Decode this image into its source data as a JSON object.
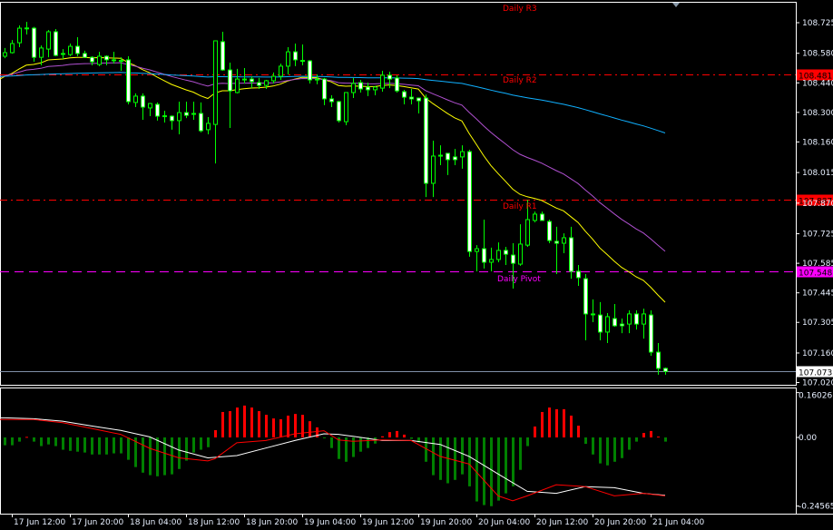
{
  "chart_data": {
    "type": "candlestick",
    "timeframe_step_hours": 1,
    "candles_ohlc": [
      [
        108.566,
        108.605,
        108.557,
        108.583
      ],
      [
        108.583,
        108.643,
        108.579,
        108.626
      ],
      [
        108.63,
        108.712,
        108.609,
        108.699
      ],
      [
        108.699,
        108.729,
        108.669,
        108.7
      ],
      [
        108.699,
        108.705,
        108.54,
        108.561
      ],
      [
        108.561,
        108.617,
        108.523,
        108.605
      ],
      [
        108.6,
        108.69,
        108.561,
        108.682
      ],
      [
        108.682,
        108.695,
        108.566,
        108.57
      ],
      [
        108.579,
        108.6,
        108.553,
        108.575
      ],
      [
        108.574,
        108.626,
        108.566,
        108.613
      ],
      [
        108.613,
        108.656,
        108.566,
        108.579
      ],
      [
        108.579,
        108.592,
        108.561,
        108.561
      ],
      [
        108.561,
        108.566,
        108.523,
        108.54
      ],
      [
        108.527,
        108.587,
        108.519,
        108.566
      ],
      [
        108.566,
        108.57,
        108.523,
        108.549
      ],
      [
        108.549,
        108.587,
        108.531,
        108.548
      ],
      [
        108.544,
        108.561,
        108.497,
        108.546
      ],
      [
        108.549,
        108.566,
        108.338,
        108.351
      ],
      [
        108.347,
        108.39,
        108.325,
        108.377
      ],
      [
        108.377,
        108.39,
        108.265,
        108.325
      ],
      [
        108.321,
        108.345,
        108.282,
        108.342
      ],
      [
        108.338,
        108.347,
        108.261,
        108.282
      ],
      [
        108.282,
        108.308,
        108.252,
        108.284
      ],
      [
        108.282,
        108.286,
        108.218,
        108.261
      ],
      [
        108.261,
        108.351,
        108.196,
        108.299
      ],
      [
        108.299,
        108.351,
        108.273,
        108.286
      ],
      [
        108.295,
        108.351,
        108.265,
        108.292
      ],
      [
        108.295,
        108.347,
        108.205,
        108.213
      ],
      [
        108.218,
        108.278,
        108.196,
        108.248
      ],
      [
        108.243,
        108.639,
        108.058,
        108.639
      ],
      [
        108.635,
        108.682,
        108.497,
        108.501
      ],
      [
        108.501,
        108.536,
        108.226,
        108.402
      ],
      [
        108.394,
        108.506,
        108.39,
        108.458
      ],
      [
        108.458,
        108.51,
        108.437,
        108.456
      ],
      [
        108.458,
        108.471,
        108.415,
        108.446
      ],
      [
        108.441,
        108.463,
        108.411,
        108.428
      ],
      [
        108.428,
        108.454,
        108.411,
        108.45
      ],
      [
        108.45,
        108.489,
        108.437,
        108.471
      ],
      [
        108.471,
        108.531,
        108.454,
        108.519
      ],
      [
        108.519,
        108.609,
        108.48,
        108.587
      ],
      [
        108.587,
        108.626,
        108.519,
        108.549
      ],
      [
        108.544,
        108.622,
        108.523,
        108.546
      ],
      [
        108.544,
        108.548,
        108.437,
        108.454
      ],
      [
        108.458,
        108.48,
        108.433,
        108.456
      ],
      [
        108.458,
        108.463,
        108.334,
        108.364
      ],
      [
        108.364,
        108.381,
        108.325,
        108.351
      ],
      [
        108.351,
        108.355,
        108.252,
        108.261
      ],
      [
        108.256,
        108.394,
        108.239,
        108.394
      ],
      [
        108.394,
        108.463,
        108.368,
        108.437
      ],
      [
        108.441,
        108.454,
        108.394,
        108.411
      ],
      [
        108.42,
        108.441,
        108.377,
        108.407
      ],
      [
        108.407,
        108.424,
        108.381,
        108.42
      ],
      [
        108.415,
        108.497,
        108.398,
        108.476
      ],
      [
        108.476,
        108.493,
        108.415,
        108.458
      ],
      [
        108.463,
        108.476,
        108.394,
        108.402
      ],
      [
        108.398,
        108.407,
        108.338,
        108.372
      ],
      [
        108.372,
        108.411,
        108.338,
        108.364
      ],
      [
        108.368,
        108.371,
        108.295,
        108.355
      ],
      [
        108.368,
        108.385,
        107.899,
        107.964
      ],
      [
        107.964,
        108.166,
        107.899,
        108.093
      ],
      [
        108.097,
        108.144,
        108.05,
        108.095
      ],
      [
        108.106,
        108.106,
        108.003,
        108.076
      ],
      [
        108.089,
        108.127,
        108.05,
        108.076
      ],
      [
        108.089,
        108.144,
        108.033,
        108.114
      ],
      [
        108.114,
        108.123,
        107.616,
        107.641
      ],
      [
        107.641,
        107.671,
        107.547,
        107.654
      ],
      [
        107.654,
        107.792,
        107.56,
        107.59
      ],
      [
        107.59,
        107.659,
        107.547,
        107.603
      ],
      [
        107.603,
        107.684,
        107.59,
        107.646
      ],
      [
        107.646,
        107.663,
        107.577,
        107.628
      ],
      [
        107.624,
        107.68,
        107.465,
        107.585
      ],
      [
        107.581,
        107.77,
        107.573,
        107.676
      ],
      [
        107.671,
        107.886,
        107.663,
        107.792
      ],
      [
        107.788,
        107.83,
        107.779,
        107.818
      ],
      [
        107.818,
        107.83,
        107.788,
        107.788
      ],
      [
        107.783,
        107.792,
        107.68,
        107.693
      ],
      [
        107.689,
        107.758,
        107.534,
        107.68
      ],
      [
        107.68,
        107.727,
        107.633,
        107.706
      ],
      [
        107.706,
        107.758,
        107.512,
        107.547
      ],
      [
        107.547,
        107.577,
        107.478,
        107.517
      ],
      [
        107.512,
        107.534,
        107.22,
        107.345
      ],
      [
        107.345,
        107.414,
        107.306,
        107.343
      ],
      [
        107.34,
        107.401,
        107.22,
        107.259
      ],
      [
        107.259,
        107.349,
        107.207,
        107.332
      ],
      [
        107.323,
        107.392,
        107.284,
        107.289
      ],
      [
        107.297,
        107.323,
        107.254,
        107.289
      ],
      [
        107.297,
        107.362,
        107.254,
        107.345
      ],
      [
        107.345,
        107.362,
        107.271,
        107.297
      ],
      [
        107.297,
        107.37,
        107.228,
        107.345
      ],
      [
        107.34,
        107.362,
        107.147,
        107.164
      ],
      [
        107.164,
        107.207,
        107.057,
        107.087
      ],
      [
        107.087,
        107.091,
        107.057,
        107.073
      ]
    ],
    "ylim": [
      107.0,
      108.76
    ],
    "price_axis_ticks": [
      "108.725",
      "108.580",
      "108.440",
      "108.300",
      "108.160",
      "108.015",
      "107.870",
      "107.725",
      "107.585",
      "107.445",
      "107.305",
      "107.160",
      "107.020"
    ],
    "time_axis_labels": [
      "17 Jun 12:00",
      "17 Jun 20:00",
      "18 Jun 04:00",
      "18 Jun 12:00",
      "18 Jun 20:00",
      "19 Jun 04:00",
      "19 Jun 12:00",
      "19 Jun 20:00",
      "20 Jun 04:00",
      "20 Jun 12:00",
      "20 Jun 20:00",
      "21 Jun 04:00"
    ],
    "pivot_levels": [
      {
        "label": "Daily R3",
        "price": null,
        "color": "#ff0000"
      },
      {
        "label": "Daily R2",
        "price": 108.481,
        "tag": "108.481",
        "color": "#ff0000"
      },
      {
        "label": "Daily R1",
        "price": 107.887,
        "tag": "107.887",
        "color": "#ff0000"
      },
      {
        "label": "Daily Pivot",
        "price": 107.548,
        "tag": "107.548",
        "color": "#ff00ff"
      }
    ],
    "current_price": {
      "price": 107.073,
      "tag": "107.073",
      "color": "#8090a8"
    },
    "moving_average_colors": {
      "fast": "#ffff00",
      "medium": "#b050d0",
      "slow": "#10b0ff"
    },
    "oscillator": {
      "ylim": [
        -0.26,
        0.17
      ],
      "axis_ticks": [
        "0.16026",
        "0.00",
        "-0.24565"
      ],
      "axis_tick_values": [
        0.16026,
        0,
        -0.24565
      ],
      "histogram": [
        -0.028,
        -0.028,
        -0.015,
        0.002,
        -0.015,
        -0.031,
        -0.025,
        -0.031,
        -0.044,
        -0.048,
        -0.051,
        -0.054,
        -0.061,
        -0.061,
        -0.061,
        -0.057,
        -0.057,
        -0.08,
        -0.106,
        -0.126,
        -0.135,
        -0.139,
        -0.135,
        -0.132,
        -0.113,
        -0.083,
        -0.054,
        -0.044,
        -0.035,
        0.026,
        0.091,
        0.094,
        0.107,
        0.114,
        0.107,
        0.094,
        0.081,
        0.068,
        0.065,
        0.078,
        0.084,
        0.081,
        0.058,
        0.036,
        -0.002,
        -0.038,
        -0.077,
        -0.087,
        -0.07,
        -0.051,
        -0.038,
        -0.022,
        0.004,
        0.019,
        0.023,
        0.01,
        -0.005,
        -0.018,
        -0.087,
        -0.135,
        -0.152,
        -0.164,
        -0.152,
        -0.132,
        -0.175,
        -0.229,
        -0.242,
        -0.246,
        -0.226,
        -0.2,
        -0.175,
        -0.116,
        -0.031,
        0.039,
        0.091,
        0.107,
        0.101,
        0.101,
        0.078,
        0.042,
        -0.023,
        -0.061,
        -0.093,
        -0.1,
        -0.087,
        -0.074,
        -0.044,
        -0.015,
        0.016,
        0.023,
        0.003,
        -0.015
      ],
      "white_line": [
        [
          0,
          0.07
        ],
        [
          4,
          0.067
        ],
        [
          8,
          0.058
        ],
        [
          12,
          0.041
        ],
        [
          16,
          0.025
        ],
        [
          20,
          0.002
        ],
        [
          24,
          -0.045
        ],
        [
          28,
          -0.073
        ],
        [
          32,
          -0.065
        ],
        [
          36,
          -0.038
        ],
        [
          40,
          -0.011
        ],
        [
          44,
          0.013
        ],
        [
          46,
          0.011
        ],
        [
          48,
          0.004
        ],
        [
          52,
          -0.011
        ],
        [
          56,
          -0.011
        ],
        [
          60,
          -0.025
        ],
        [
          64,
          -0.068
        ],
        [
          68,
          -0.131
        ],
        [
          72,
          -0.193
        ],
        [
          76,
          -0.2
        ],
        [
          80,
          -0.176
        ],
        [
          84,
          -0.18
        ],
        [
          88,
          -0.2
        ],
        [
          91,
          -0.207
        ]
      ],
      "red_line": [
        [
          0,
          0.064
        ],
        [
          4,
          0.064
        ],
        [
          8,
          0.053
        ],
        [
          12,
          0.032
        ],
        [
          16,
          0.011
        ],
        [
          20,
          -0.039
        ],
        [
          24,
          -0.073
        ],
        [
          28,
          -0.084
        ],
        [
          29,
          -0.076
        ],
        [
          32,
          -0.019
        ],
        [
          36,
          -0.011
        ],
        [
          40,
          0.013
        ],
        [
          44,
          0.024
        ],
        [
          46,
          -0.009
        ],
        [
          48,
          -0.014
        ],
        [
          52,
          -0.009
        ],
        [
          56,
          -0.011
        ],
        [
          60,
          -0.068
        ],
        [
          64,
          -0.095
        ],
        [
          68,
          -0.209
        ],
        [
          70,
          -0.227
        ],
        [
          72,
          -0.209
        ],
        [
          76,
          -0.169
        ],
        [
          80,
          -0.176
        ],
        [
          84,
          -0.209
        ],
        [
          88,
          -0.2
        ],
        [
          91,
          -0.209
        ]
      ],
      "positive_color": "#ff0000",
      "negative_color": "#008000"
    }
  }
}
